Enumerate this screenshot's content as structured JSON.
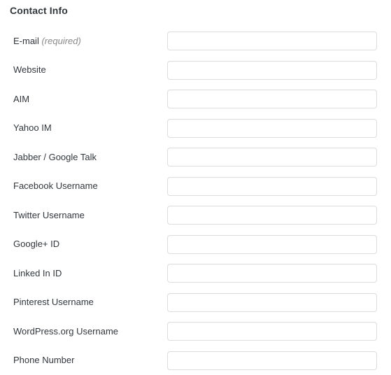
{
  "section": {
    "title": "Contact Info"
  },
  "colors": {
    "background": "#ffffff",
    "heading_text": "#32373c",
    "label_text": "#32373c",
    "muted_text": "#8a8a8a",
    "input_border": "#dddddd",
    "input_background": "#ffffff"
  },
  "fields": [
    {
      "label": "E-mail",
      "suffix": "(required)",
      "value": "",
      "placeholder": ""
    },
    {
      "label": "Website",
      "suffix": "",
      "value": "",
      "placeholder": ""
    },
    {
      "label": "AIM",
      "suffix": "",
      "value": "",
      "placeholder": ""
    },
    {
      "label": "Yahoo IM",
      "suffix": "",
      "value": "",
      "placeholder": ""
    },
    {
      "label": "Jabber / Google Talk",
      "suffix": "",
      "value": "",
      "placeholder": ""
    },
    {
      "label": "Facebook Username",
      "suffix": "",
      "value": "",
      "placeholder": ""
    },
    {
      "label": "Twitter Username",
      "suffix": "",
      "value": "",
      "placeholder": ""
    },
    {
      "label": "Google+ ID",
      "suffix": "",
      "value": "",
      "placeholder": ""
    },
    {
      "label": "Linked In ID",
      "suffix": "",
      "value": "",
      "placeholder": ""
    },
    {
      "label": "Pinterest Username",
      "suffix": "",
      "value": "",
      "placeholder": ""
    },
    {
      "label": "WordPress.org Username",
      "suffix": "",
      "value": "",
      "placeholder": ""
    },
    {
      "label": "Phone Number",
      "suffix": "",
      "value": "",
      "placeholder": ""
    }
  ]
}
